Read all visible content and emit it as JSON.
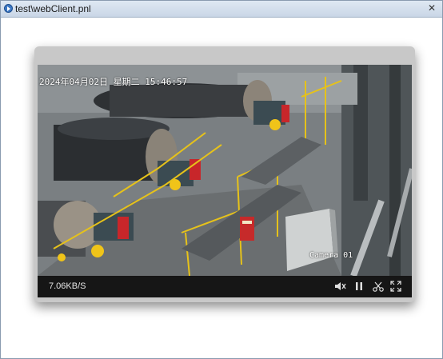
{
  "window": {
    "title": "test\\webClient.pnl",
    "close_glyph": "✕",
    "icon": "app-play-icon"
  },
  "video": {
    "osd_datetime": "2024年04月02日 星期二 15:46:57",
    "osd_camera": "Camera 01",
    "scene": "industrial-plant-camera-feed"
  },
  "controls": {
    "bitrate": "7.06KB/S",
    "buttons": [
      {
        "name": "mute-icon"
      },
      {
        "name": "pause-icon"
      },
      {
        "name": "snapshot-scissors-icon"
      },
      {
        "name": "fullscreen-icon"
      }
    ]
  },
  "colors": {
    "titlebar": "#c9d6e6",
    "control_bar": "#161616",
    "frame": "#c8c8c8",
    "railing_yellow": "#e6c21a",
    "motor_red": "#c8262a"
  }
}
